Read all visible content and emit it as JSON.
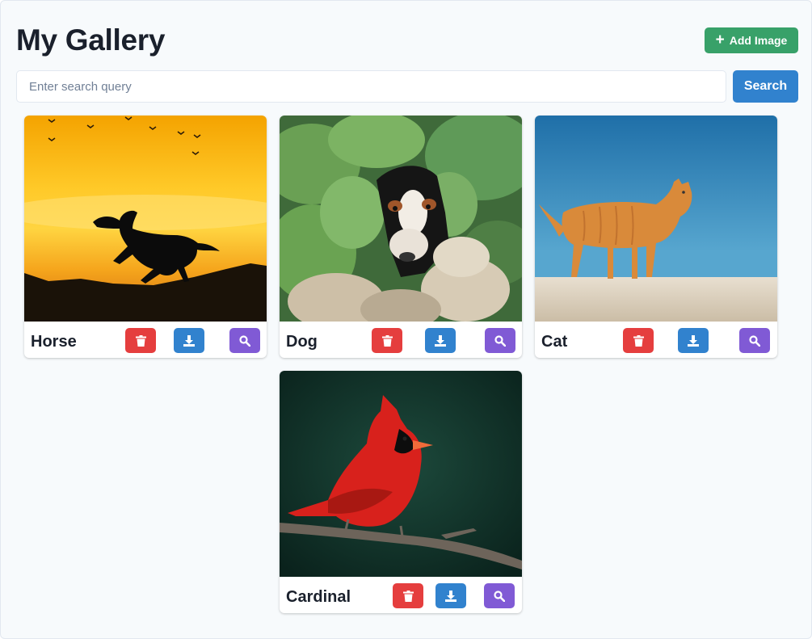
{
  "header": {
    "title": "My Gallery",
    "add_label": "Add Image"
  },
  "search": {
    "placeholder": "Enter search query",
    "value": "",
    "button_label": "Search"
  },
  "colors": {
    "delete": "#e53e3e",
    "download": "#3182ce",
    "zoom": "#805ad5",
    "add": "#38a169"
  },
  "icons": {
    "delete": "trash-icon",
    "download": "download-icon",
    "zoom": "magnifier-icon",
    "add": "plus-icon"
  },
  "cards": [
    {
      "title": "Horse",
      "image": "horse-silhouette-sunset"
    },
    {
      "title": "Dog",
      "image": "puppy-in-leaves"
    },
    {
      "title": "Cat",
      "image": "orange-cat-walking"
    },
    {
      "title": "Cardinal",
      "image": "red-cardinal-on-branch"
    }
  ]
}
